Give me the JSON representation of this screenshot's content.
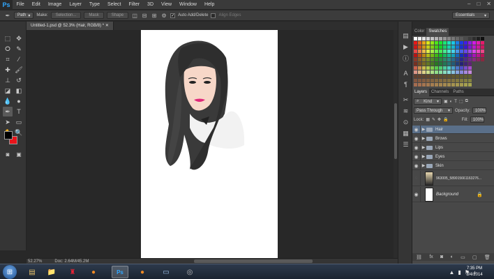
{
  "app": {
    "logo": "Ps"
  },
  "menu": [
    "File",
    "Edit",
    "Image",
    "Layer",
    "Type",
    "Select",
    "Filter",
    "3D",
    "View",
    "Window",
    "Help"
  ],
  "options_bar": {
    "tool_mode": "Path",
    "make_label": "Make:",
    "selection_btn": "Selection...",
    "mask_btn": "Mask",
    "shape_btn": "Shape",
    "auto_add_delete": "Auto Add/Delete",
    "align_edges": "Align Edges",
    "workspace": "Essentials"
  },
  "document": {
    "tab_title": "Untitled-1.psd @ 52.3% (Hair, RGB/8) *"
  },
  "status": {
    "zoom": "52.27%",
    "doc_size": "Doc: 2.64M/45.2M"
  },
  "colors": {
    "foreground": "#000000",
    "background": "#e8141b"
  },
  "panels": {
    "swatch_tabs": [
      "Color",
      "Swatches"
    ],
    "layer_tabs": [
      "Layers",
      "Channels",
      "Paths"
    ],
    "kind_label": "Kind",
    "blend_mode": "Pass Through",
    "opacity_label": "Opacity:",
    "opacity": "100%",
    "lock_label": "Lock:",
    "fill_label": "Fill:",
    "fill": "100%"
  },
  "layers": [
    {
      "name": "Hair",
      "type": "group",
      "selected": true
    },
    {
      "name": "Brows",
      "type": "group",
      "selected": false
    },
    {
      "name": "Lips",
      "type": "group",
      "selected": false
    },
    {
      "name": "Eyes",
      "type": "group",
      "selected": false
    },
    {
      "name": "Skin",
      "type": "group",
      "selected": false
    },
    {
      "name": "963005_589015661163276...",
      "type": "image",
      "selected": false
    },
    {
      "name": "Background",
      "type": "background",
      "selected": false
    }
  ],
  "taskbar": {
    "time": "7:35 PM",
    "date": "8/4/2014"
  }
}
